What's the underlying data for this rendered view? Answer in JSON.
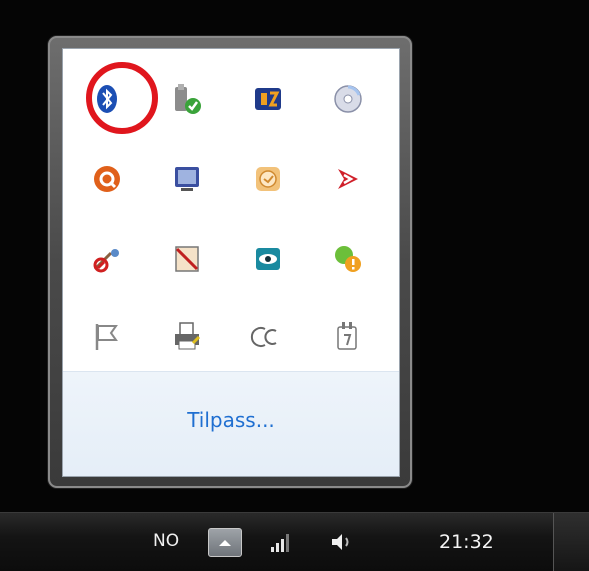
{
  "flyout": {
    "customize_link": "Tilpass...",
    "icons": [
      {
        "name": "bluetooth-icon",
        "color": "#1c4fb4",
        "highlighted": true
      },
      {
        "name": "safely-remove-hardware-icon",
        "color": "#3aa33a"
      },
      {
        "name": "media-app-icon",
        "color": "#1f3a8a"
      },
      {
        "name": "cd-drive-icon",
        "color": "#9aa8c8"
      },
      {
        "name": "orange-app-icon",
        "color": "#e0601a"
      },
      {
        "name": "display-icon",
        "color": "#3a4fa0"
      },
      {
        "name": "clock-app-icon",
        "color": "#e8a040"
      },
      {
        "name": "red-arrow-icon",
        "color": "#d0202a"
      },
      {
        "name": "network-disabled-icon",
        "color": "#c44"
      },
      {
        "name": "no-device-icon",
        "color": "#c02020"
      },
      {
        "name": "eye-app-icon",
        "color": "#1a8aa0"
      },
      {
        "name": "warning-app-icon",
        "color": "#e8a020"
      },
      {
        "name": "action-center-flag-icon",
        "color": "#888888"
      },
      {
        "name": "printer-icon",
        "color": "#555555"
      },
      {
        "name": "cc-icon",
        "color": "#666666"
      },
      {
        "name": "power-plug-icon",
        "color": "#777777"
      }
    ],
    "highlight_color": "#e0161d"
  },
  "taskbar": {
    "language": "NO",
    "clock": "21:32"
  }
}
